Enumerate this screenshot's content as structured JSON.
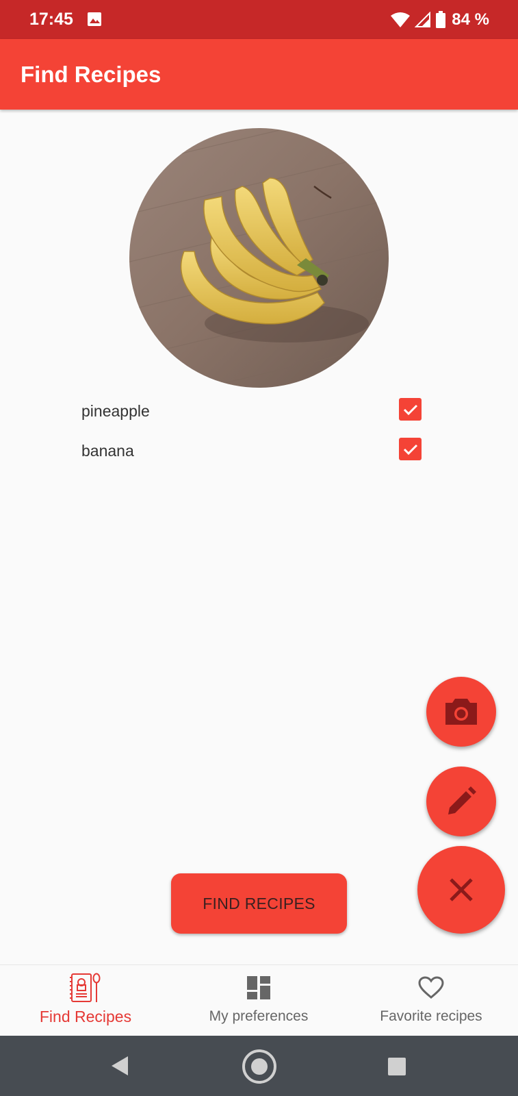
{
  "status_bar": {
    "time": "17:45",
    "battery_text": "84 %",
    "icons": [
      "image-notification-icon",
      "wifi-icon",
      "cellular-signal-icon",
      "battery-icon"
    ]
  },
  "app_bar": {
    "title": "Find Recipes"
  },
  "photo": {
    "subject": "banana"
  },
  "ingredients": [
    {
      "name": "pineapple",
      "checked": true
    },
    {
      "name": "banana",
      "checked": true
    }
  ],
  "actions": {
    "find_button_label": "FIND RECIPES",
    "fab_icons": [
      "camera-icon",
      "pencil-icon",
      "close-icon"
    ]
  },
  "bottom_nav": {
    "items": [
      {
        "label": "Find Recipes",
        "icon": "recipe-book-icon",
        "active": true
      },
      {
        "label": "My preferences",
        "icon": "dashboard-icon",
        "active": false
      },
      {
        "label": "Favorite recipes",
        "icon": "heart-icon",
        "active": false
      }
    ]
  },
  "colors": {
    "status_bar": "#c62828",
    "primary": "#f44336",
    "active_nav": "#e53935",
    "system_nav": "#474c52"
  }
}
